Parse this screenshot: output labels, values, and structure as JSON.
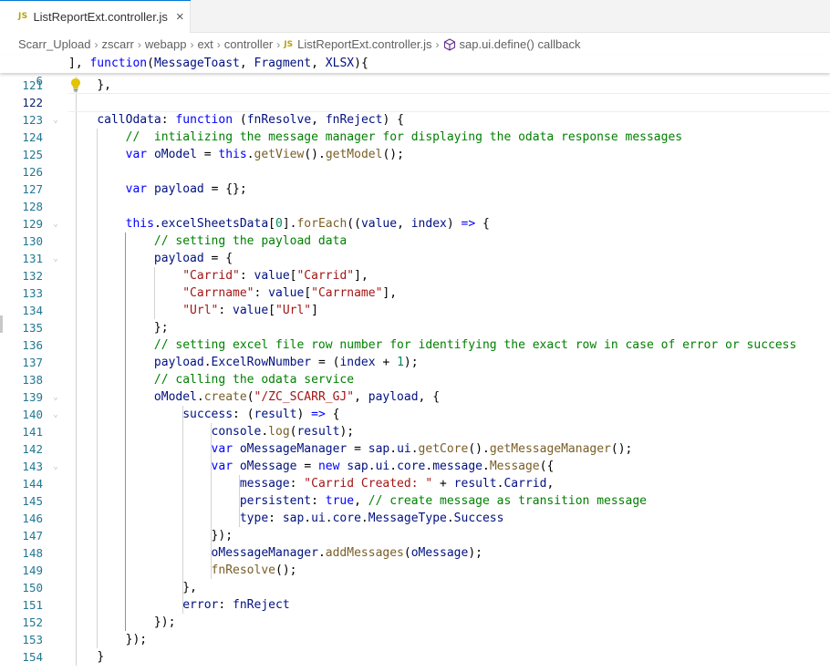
{
  "tab": {
    "badge": "JS",
    "label": "ListReportExt.controller.js",
    "close": "×"
  },
  "breadcrumb": {
    "items": [
      "Scarr_Upload",
      "zscarr",
      "webapp",
      "ext",
      "controller"
    ],
    "file_badge": "JS",
    "file": "ListReportExt.controller.js",
    "symbol": "sap.ui.define() callback",
    "separator": "›"
  },
  "sticky": {
    "line_number": "6",
    "text": "], function(MessageToast, Fragment, XLSX){"
  },
  "lines": [
    {
      "n": "121",
      "text": "    },"
    },
    {
      "n": "122",
      "text": ""
    },
    {
      "n": "123",
      "text": "    callOdata: function (fnResolve, fnReject) {"
    },
    {
      "n": "124",
      "text": "        //  intializing the message manager for displaying the odata response messages"
    },
    {
      "n": "125",
      "text": "        var oModel = this.getView().getModel();"
    },
    {
      "n": "126",
      "text": ""
    },
    {
      "n": "127",
      "text": "        var payload = {};"
    },
    {
      "n": "128",
      "text": ""
    },
    {
      "n": "129",
      "text": "        this.excelSheetsData[0].forEach((value, index) => {"
    },
    {
      "n": "130",
      "text": "            // setting the payload data"
    },
    {
      "n": "131",
      "text": "            payload = {"
    },
    {
      "n": "132",
      "text": "                \"Carrid\": value[\"Carrid\"],"
    },
    {
      "n": "133",
      "text": "                \"Carrname\": value[\"Carrname\"],"
    },
    {
      "n": "134",
      "text": "                \"Url\": value[\"Url\"]"
    },
    {
      "n": "135",
      "text": "            };"
    },
    {
      "n": "136",
      "text": "            // setting excel file row number for identifying the exact row in case of error or success"
    },
    {
      "n": "137",
      "text": "            payload.ExcelRowNumber = (index + 1);"
    },
    {
      "n": "138",
      "text": "            // calling the odata service"
    },
    {
      "n": "139",
      "text": "            oModel.create(\"/ZC_SCARR_GJ\", payload, {"
    },
    {
      "n": "140",
      "text": "                success: (result) => {"
    },
    {
      "n": "141",
      "text": "                    console.log(result);"
    },
    {
      "n": "142",
      "text": "                    var oMessageManager = sap.ui.getCore().getMessageManager();"
    },
    {
      "n": "143",
      "text": "                    var oMessage = new sap.ui.core.message.Message({"
    },
    {
      "n": "144",
      "text": "                        message: \"Carrid Created: \" + result.Carrid,"
    },
    {
      "n": "145",
      "text": "                        persistent: true, // create message as transition message"
    },
    {
      "n": "146",
      "text": "                        type: sap.ui.core.MessageType.Success"
    },
    {
      "n": "147",
      "text": "                    });"
    },
    {
      "n": "148",
      "text": "                    oMessageManager.addMessages(oMessage);"
    },
    {
      "n": "149",
      "text": "                    fnResolve();"
    },
    {
      "n": "150",
      "text": "                },"
    },
    {
      "n": "151",
      "text": "                error: fnReject"
    },
    {
      "n": "152",
      "text": "            });"
    },
    {
      "n": "153",
      "text": "        });"
    },
    {
      "n": "154",
      "text": "    }"
    }
  ],
  "colors": {
    "accent": "#0078d4",
    "line_number": "#237893",
    "keyword": "#0000ff",
    "string": "#a31515",
    "comment": "#008000",
    "function": "#795e26",
    "property": "#001080",
    "number": "#098658"
  },
  "icons": {
    "tab": "js-file-icon",
    "close": "close-icon",
    "symbol": "cube-icon",
    "gutter": "lightbulb-icon"
  }
}
